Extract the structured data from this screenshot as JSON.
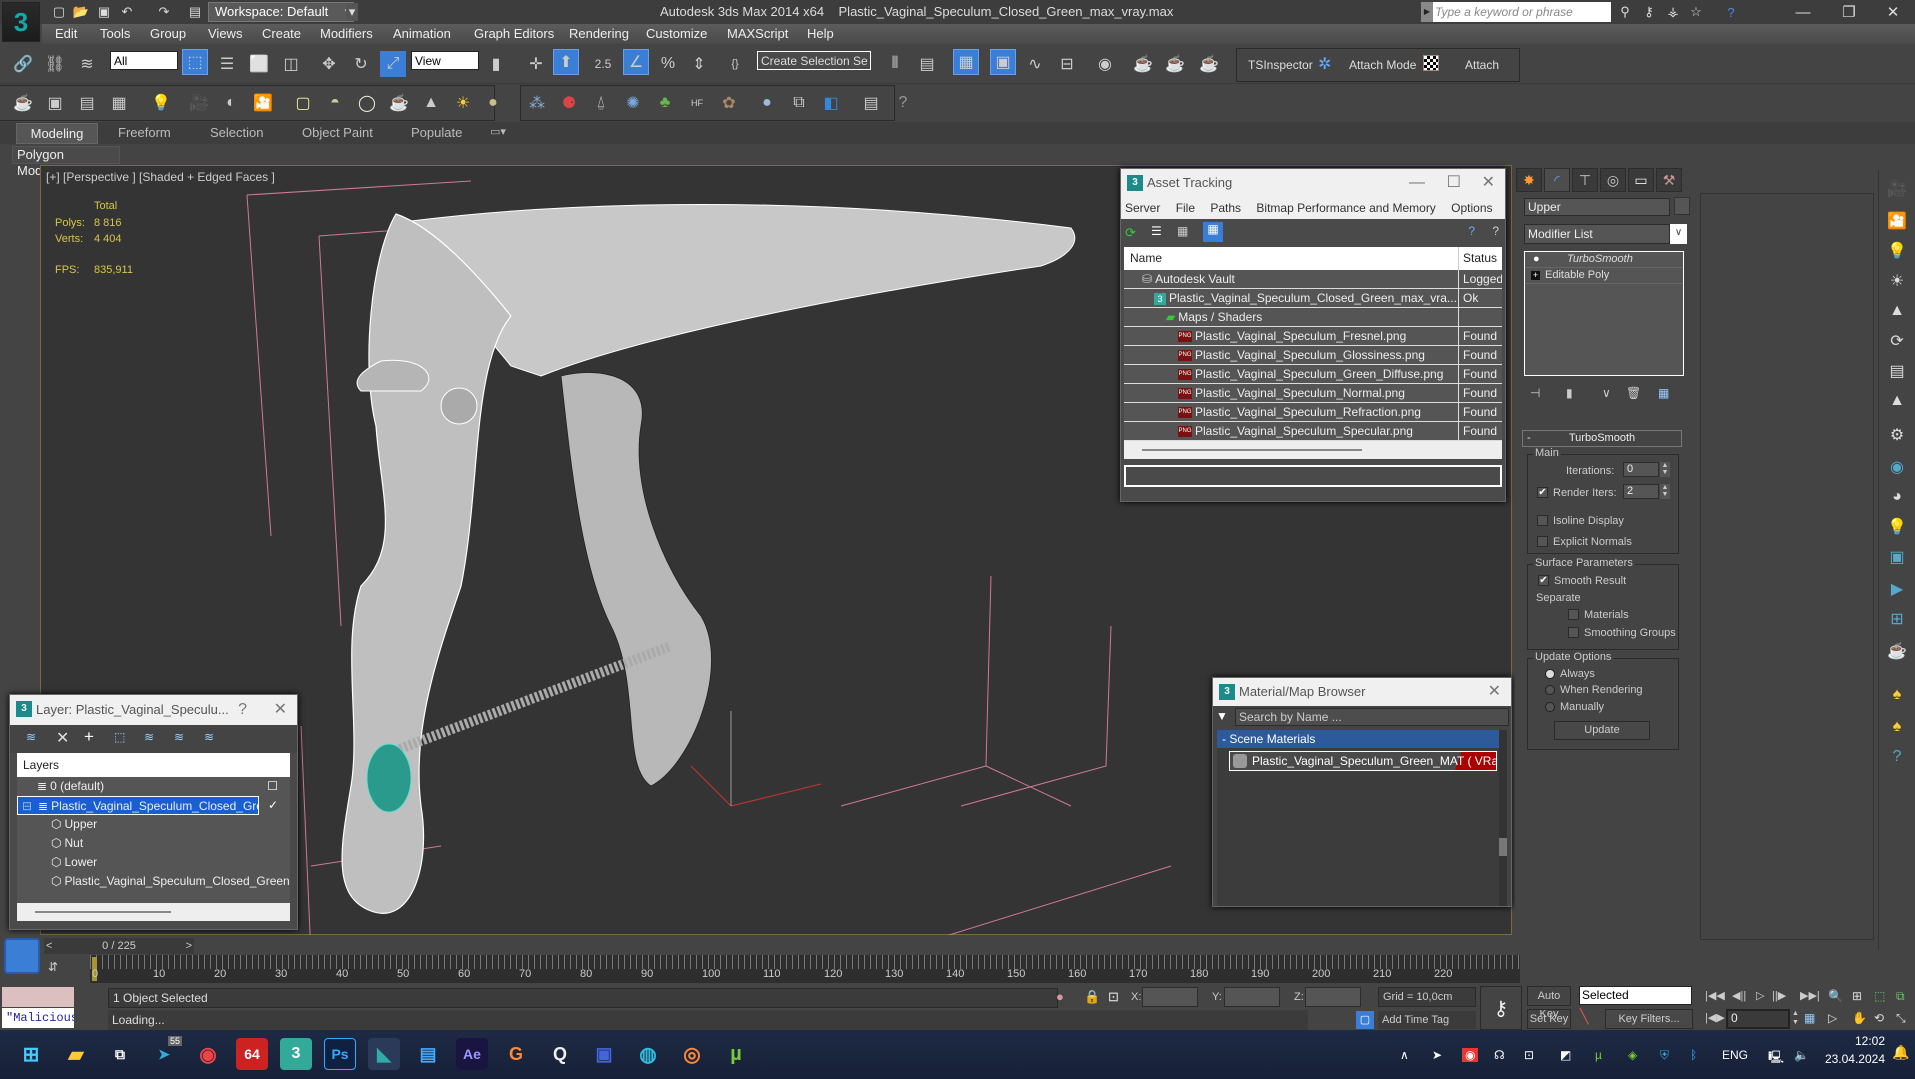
{
  "app": {
    "title": "Autodesk 3ds Max  2014 x64",
    "file": "Plastic_Vaginal_Speculum_Closed_Green_max_vray.max",
    "workspace": "Workspace: Default",
    "search_placeholder": "Type a keyword or phrase"
  },
  "menu": [
    "Edit",
    "Tools",
    "Group",
    "Views",
    "Create",
    "Modifiers",
    "Animation",
    "Graph Editors",
    "Rendering",
    "Customize",
    "MAXScript",
    "Help"
  ],
  "toolbar": {
    "selection_filter": "All",
    "ref_coord": "View",
    "snap_value": "2.5",
    "named_selection": "Create Selection Se",
    "tsinspector": "TSInspector",
    "attach_mode": "Attach Mode",
    "attach": "Attach"
  },
  "ribbon": {
    "tabs": [
      "Modeling",
      "Freeform",
      "Selection",
      "Object Paint",
      "Populate"
    ],
    "panel": "Polygon Modeling"
  },
  "viewport": {
    "label": "[+] [Perspective ] [Shaded + Edged Faces ]",
    "stats": {
      "total_label": "Total",
      "polys_label": "Polys:",
      "polys": "8 816",
      "verts_label": "Verts:",
      "verts": "4 404",
      "fps_label": "FPS:",
      "fps": "835,911"
    }
  },
  "asset_tracking": {
    "title": "Asset Tracking",
    "menu": [
      "Server",
      "File",
      "Paths",
      "Bitmap Performance and Memory",
      "Options"
    ],
    "columns": [
      "Name",
      "Status"
    ],
    "rows": [
      {
        "name": "Autodesk Vault",
        "status": "Logged",
        "indent": 1,
        "icon": "vault"
      },
      {
        "name": "Plastic_Vaginal_Speculum_Closed_Green_max_vra...",
        "status": "Ok",
        "indent": 2,
        "icon": "max"
      },
      {
        "name": "Maps / Shaders",
        "status": "",
        "indent": 3,
        "icon": "maps"
      },
      {
        "name": "Plastic_Vaginal_Speculum_Fresnel.png",
        "status": "Found",
        "indent": 4,
        "icon": "png"
      },
      {
        "name": "Plastic_Vaginal_Speculum_Glossiness.png",
        "status": "Found",
        "indent": 4,
        "icon": "png"
      },
      {
        "name": "Plastic_Vaginal_Speculum_Green_Diffuse.png",
        "status": "Found",
        "indent": 4,
        "icon": "png"
      },
      {
        "name": "Plastic_Vaginal_Speculum_Normal.png",
        "status": "Found",
        "indent": 4,
        "icon": "png"
      },
      {
        "name": "Plastic_Vaginal_Speculum_Refraction.png",
        "status": "Found",
        "indent": 4,
        "icon": "png"
      },
      {
        "name": "Plastic_Vaginal_Speculum_Specular.png",
        "status": "Found",
        "indent": 4,
        "icon": "png"
      }
    ]
  },
  "layer_dialog": {
    "title": "Layer: Plastic_Vaginal_Speculu...",
    "help": "?",
    "header": "Layers",
    "rows": [
      {
        "name": "0 (default)",
        "level": 0,
        "selected": false
      },
      {
        "name": "Plastic_Vaginal_Speculum_Closed_Green",
        "level": 0,
        "selected": true
      },
      {
        "name": "Upper",
        "level": 1,
        "selected": false
      },
      {
        "name": "Nut",
        "level": 1,
        "selected": false
      },
      {
        "name": "Lower",
        "level": 1,
        "selected": false
      },
      {
        "name": "Plastic_Vaginal_Speculum_Closed_Green",
        "level": 1,
        "selected": false
      }
    ]
  },
  "material_browser": {
    "title": "Material/Map Browser",
    "search_placeholder": "Search by Name ...",
    "group": "- Scene Materials",
    "item": "Plastic_Vaginal_Speculum_Green_MAT  ( VRay..."
  },
  "command_panel": {
    "object_name": "Upper",
    "modifier_list": "Modifier List",
    "stack": [
      "TurboSmooth",
      "Editable Poly"
    ],
    "rollout": "TurboSmooth",
    "main_label": "Main",
    "iterations_label": "Iterations:",
    "iterations": "0",
    "render_iters_label": "Render Iters:",
    "render_iters": "2",
    "isoline": "Isoline Display",
    "explicit": "Explicit Normals",
    "surface_label": "Surface Parameters",
    "smooth_result": "Smooth Result",
    "separate": "Separate",
    "materials": "Materials",
    "smoothing_groups": "Smoothing Groups",
    "update_label": "Update Options",
    "always": "Always",
    "when_rendering": "When Rendering",
    "manually": "Manually",
    "update_btn": "Update"
  },
  "timeline": {
    "frame": "0 / 225",
    "ticks": [
      "0",
      "10",
      "20",
      "30",
      "40",
      "50",
      "60",
      "70",
      "80",
      "90",
      "100",
      "110",
      "120",
      "130",
      "140",
      "150",
      "160",
      "170",
      "180",
      "190",
      "200",
      "210",
      "220"
    ]
  },
  "status": {
    "maxscript": "\"Malicious s",
    "selected": "1 Object Selected",
    "prompt": "Loading...",
    "x_label": "X:",
    "y_label": "Y:",
    "z_label": "Z:",
    "grid": "Grid = 10,0cm",
    "add_time_tag": "Add Time Tag",
    "auto_key": "Auto Key",
    "set_key": "Set Key",
    "key_mode": "Selected",
    "key_filters": "Key Filters...",
    "current_frame": "0"
  },
  "taskbar": {
    "apps": [
      "Start",
      "File Explorer",
      "Task View",
      "Telegram",
      "Chrome",
      "AIDA64",
      "3ds Max",
      "Photoshop",
      "3ds Max 2014",
      "Notepad",
      "After Effects",
      "Topaz Gigapixel",
      "Photo Viewer",
      "Save",
      "Edge",
      "Radmin",
      "uTorrent"
    ],
    "telegram_badge": "55",
    "lang": "ENG",
    "time": "12:02",
    "date": "23.04.2024"
  }
}
